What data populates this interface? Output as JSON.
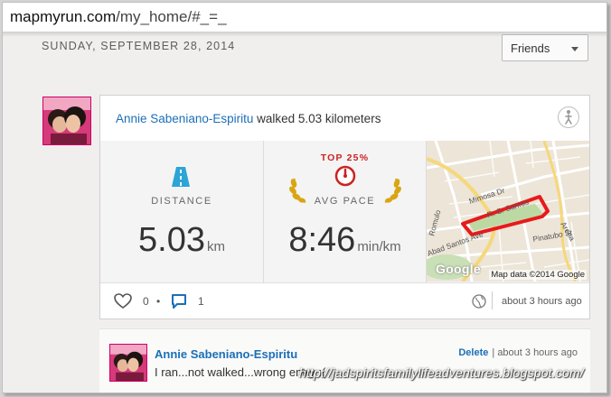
{
  "browser": {
    "url_domain": "mapmyrun.com",
    "url_path": "/my_home/#_=_"
  },
  "feed": {
    "date": "SUNDAY, SEPTEMBER 28, 2014",
    "filter": {
      "selected": "Friends"
    }
  },
  "activity": {
    "user": "Annie Sabeniano-Espiritu",
    "action": "walked 5.03 kilometers",
    "distance": {
      "label": "DISTANCE",
      "value": "5.03",
      "unit": "km"
    },
    "pace": {
      "badge": "TOP 25%",
      "label": "AVG PACE",
      "value": "8:46",
      "unit": "min/km"
    },
    "map": {
      "credit": "Map data ©2014 Google",
      "logo": "Google",
      "streets": [
        "Mimosa Dr",
        "R. S. Santos",
        "Romulo",
        "Abad Santos Ave",
        "Pinatubo St",
        "Arena"
      ]
    },
    "likes": "0",
    "comments": "1",
    "time": "about 3 hours ago"
  },
  "comment": {
    "user": "Annie Sabeniano-Espiritu",
    "text": "I ran...not walked...wrong entry :(",
    "delete_label": "Delete",
    "time": "about 3 hours ago"
  },
  "watermark": "http://jadspiritsfamilylifeadventures.blogspot.com/",
  "colors": {
    "link": "#1b6fb8",
    "route": "#e81a1a",
    "badge": "#cc2222",
    "distance_icon": "#2aa5d6",
    "laurel": "#d9a514"
  },
  "icons": [
    "road-icon",
    "pace-gauge-icon",
    "laurel-icon",
    "walker-icon",
    "heart-icon",
    "comment-icon",
    "globe-icon",
    "chevron-down-icon"
  ]
}
